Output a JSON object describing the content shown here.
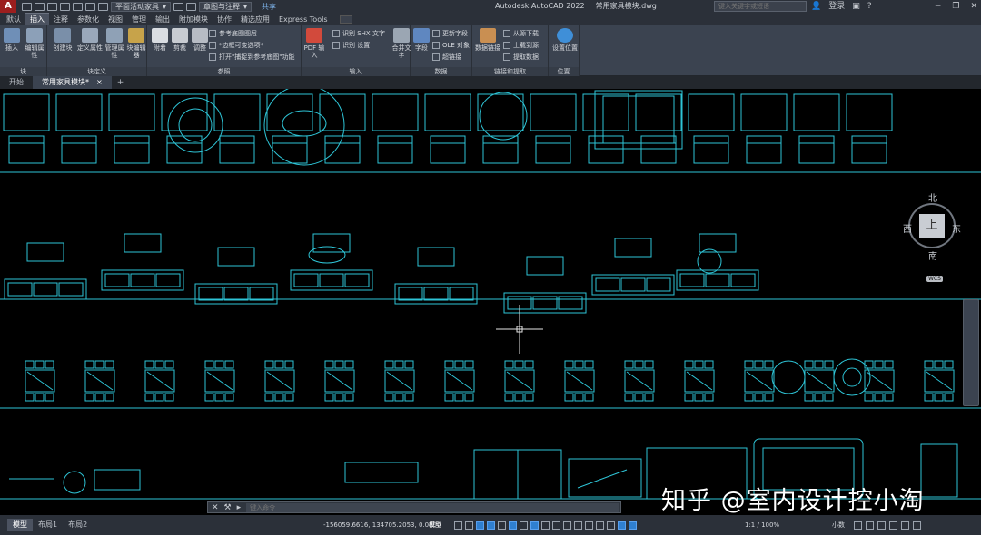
{
  "app": {
    "logo": "A",
    "product": "Autodesk AutoCAD 2022",
    "filename": "常用家具模块.dwg",
    "workspace": "平面活动家具",
    "layer_state": "章图与注释",
    "share_label": "共享",
    "search_placeholder": "键入关键字或短语",
    "login_label": "登录"
  },
  "ribbon_tabs": [
    "默认",
    "插入",
    "注释",
    "参数化",
    "视图",
    "管理",
    "输出",
    "附加模块",
    "协作",
    "精选应用",
    "Express Tools"
  ],
  "active_tab": "插入",
  "panels": {
    "block": {
      "title": "块",
      "insert": "插入",
      "edit_attr": "编辑属性"
    },
    "block_def": {
      "title": "块定义",
      "create": "创建块",
      "define_attr": "定义属性",
      "manage_attr": "管理属性",
      "block_editor": "块编辑器"
    },
    "reference": {
      "title": "参照",
      "attach": "附着",
      "clip": "剪裁",
      "adjust": "调整",
      "underlay_layers": "参考底图图层",
      "frame_variable": "*边框可变选项*",
      "snap_option": "打开\"捕捉到参考底图\"功能"
    },
    "import": {
      "title": "输入",
      "pdf_import": "PDF 输入",
      "recognize_shx": "识别 SHX 文字",
      "recognize_settings": "识别 设置"
    },
    "data": {
      "title": "数据",
      "combine_text": "合并文字",
      "field": "字段",
      "update_fields": "更新字段",
      "ole_object": "OLE 对象",
      "hyperlink": "超链接"
    },
    "linking": {
      "title": "链接和提取",
      "data_link": "数据链接",
      "download_source": "从源下载",
      "upload_source": "上载到源",
      "extract_data": "提取数据"
    },
    "location": {
      "title": "位置",
      "set_location": "设置位置"
    }
  },
  "file_tabs": [
    "开始",
    "常用家具模块*"
  ],
  "active_file_tab": "常用家具模块*",
  "viewcube": {
    "top": "上",
    "north": "北",
    "south": "南",
    "east": "东",
    "west": "西",
    "wcs": "WCS"
  },
  "watermark": "知乎 @室内设计控小淘",
  "command_placeholder": "键入命令",
  "layout_tabs": [
    "模型",
    "布局1",
    "布局2"
  ],
  "active_layout": "模型",
  "status": {
    "coordinates": "-156059.6616, 134705.2053, 0.0000",
    "mode": "模型",
    "annotation_scale": "1:1 / 100%",
    "units": "小数"
  },
  "colors": {
    "cad_lines": "#2ec4d6",
    "background": "#000000",
    "ribbon": "#3b4350",
    "accent": "#2f7fd0"
  }
}
